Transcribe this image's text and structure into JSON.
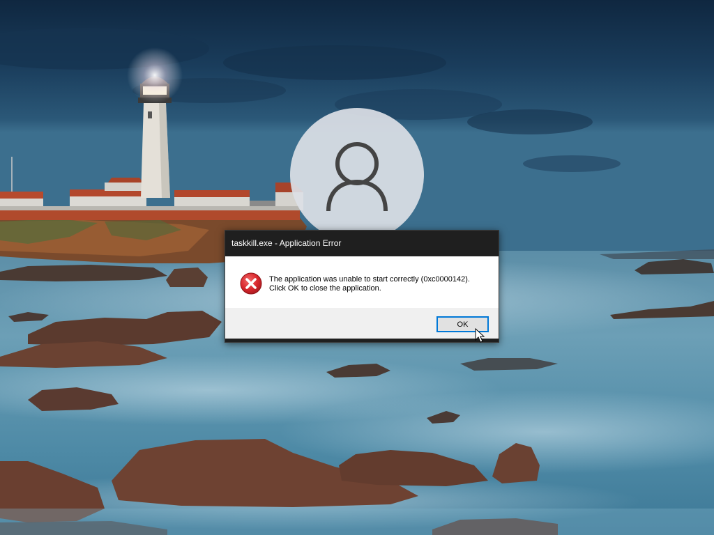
{
  "dialog": {
    "title": "taskkill.exe - Application Error",
    "message_line1": "The application was unable to start correctly (0xc0000142).",
    "message_line2": "Click OK to close the application.",
    "ok_label": "OK",
    "icon": "error-icon"
  },
  "avatar": {
    "icon": "user-icon"
  },
  "colors": {
    "titlebar": "#1f1f1f",
    "footer": "#f0f0f0",
    "error_red": "#d9262c",
    "button_focus": "#0078d7"
  }
}
